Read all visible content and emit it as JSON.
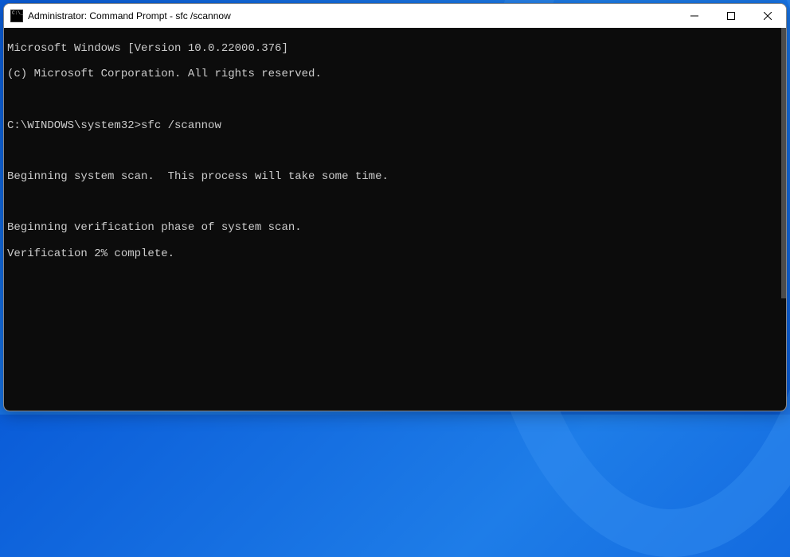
{
  "titlebar": {
    "title": "Administrator: Command Prompt - sfc  /scannow"
  },
  "terminal": {
    "line1": "Microsoft Windows [Version 10.0.22000.376]",
    "line2": "(c) Microsoft Corporation. All rights reserved.",
    "blank1": "",
    "prompt_line": "C:\\WINDOWS\\system32>sfc /scannow",
    "blank2": "",
    "scan_line": "Beginning system scan.  This process will take some time.",
    "blank3": "",
    "verify_phase": "Beginning verification phase of system scan.",
    "verify_progress": "Verification 2% complete."
  }
}
